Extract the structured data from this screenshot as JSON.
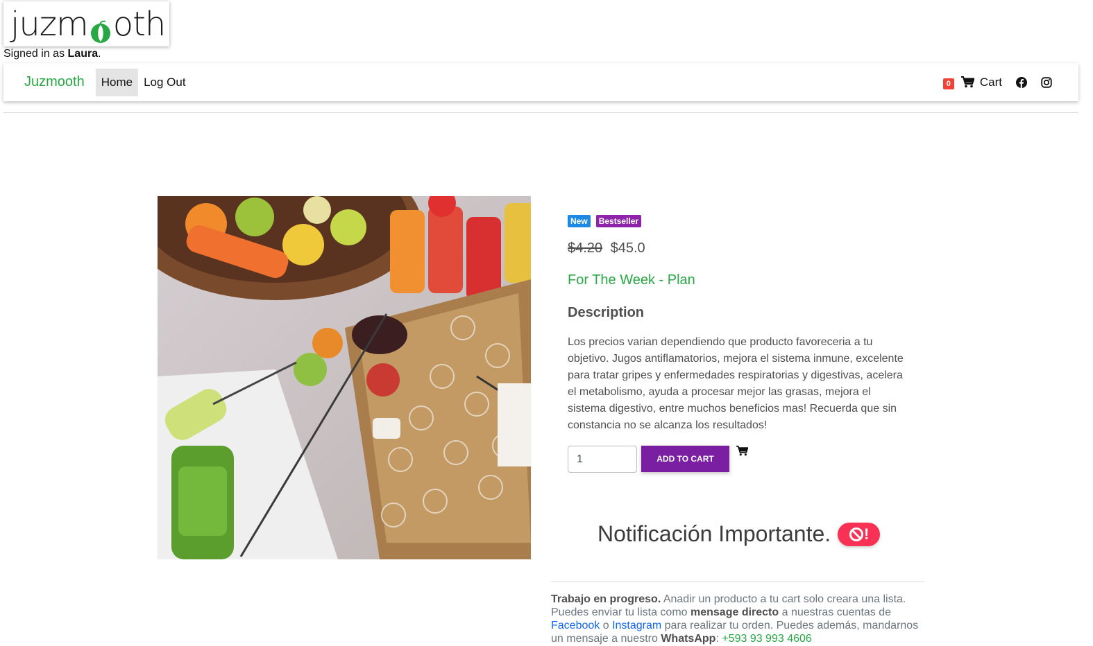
{
  "header": {
    "logo_left": "juzm",
    "logo_right": "oth",
    "signed_in_prefix": "Signed in as ",
    "user_name": "Laura",
    "signed_in_suffix": "."
  },
  "nav": {
    "brand": "Juzmooth",
    "links": [
      {
        "label": "Home",
        "active": true
      },
      {
        "label": "Log Out",
        "active": false
      }
    ],
    "cart_count": "0",
    "cart_label": "Cart",
    "icons": [
      "cart-icon",
      "facebook-icon",
      "instagram-icon"
    ]
  },
  "product": {
    "badges": [
      "New",
      "Bestseller"
    ],
    "old_price": "$4.20",
    "price": "$45.0",
    "name": "For The Week - Plan",
    "description_title": "Description",
    "description": "Los precios varian dependiendo que producto favoreceria a tu objetivo. Jugos antiflamatorios, mejora el sistema inmune, excelente para tratar gripes y enfermedades respiratorias y digestivas, acelera el metabolismo, ayuda a procesar mejor las grasas, mejora el sistema digestivo, entre muchos beneficios mas! Recuerda que sin constancia no se alcanza los resultados!",
    "quantity": "1",
    "add_to_cart_label": "ADD TO CART"
  },
  "notice": {
    "title": "Notificación Importante.",
    "badge_icon": "ban-icon",
    "badge_mark": "!",
    "lead": "Trabajo en progreso.",
    "text_1": " Anadir un producto a tu cart solo creara una lista. Puedes enviar tu lista como ",
    "bold_1": "mensage directo",
    "text_2": " a nuestras cuentas de ",
    "facebook": "Facebook",
    "text_3": " o ",
    "instagram": "Instagram",
    "text_4": " para realizar tu orden. Puedes además, mandarnos un mensaje a nuestro ",
    "bold_2": "WhatsApp",
    "text_5": ": ",
    "phone": "+593 93 993 4606"
  },
  "colors": {
    "brand_green": "#28a745",
    "button_purple": "#7b1fa2",
    "badge_new": "#1e88e5",
    "badge_best": "#8e24aa",
    "alert_red": "#f93154"
  }
}
